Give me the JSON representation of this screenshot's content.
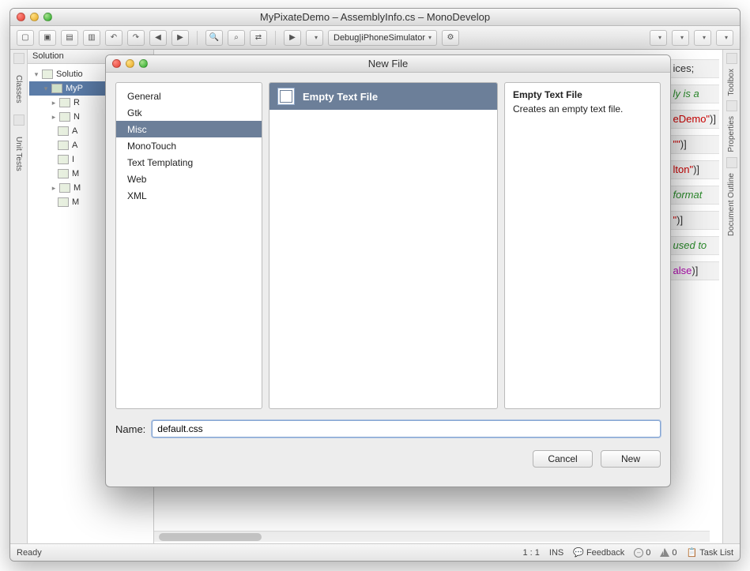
{
  "window": {
    "title": "MyPixateDemo – AssemblyInfo.cs – MonoDevelop"
  },
  "toolbar": {
    "config_label": "Debug|iPhoneSimulator"
  },
  "solution": {
    "panel_title": "Solution",
    "root": "Solutio",
    "project": "MyP",
    "items": [
      "R",
      "N",
      "A",
      "A",
      "I",
      "M",
      "M",
      "M"
    ]
  },
  "right_tabs": [
    "Toolbox",
    "Properties",
    "Document Outline"
  ],
  "left_tabs": [
    "Classes",
    "Unit Tests"
  ],
  "code": {
    "l1": "ices;",
    "l2": "ly is a",
    "l3a": "eDemo\"",
    "l3b": ")]",
    "l4a": "\"\"",
    "l4b": ")]",
    "l5a": "lton\"",
    "l5b": ")]",
    "l6": "format",
    "l7a": "\"",
    "l7b": ")]",
    "l8": "used to",
    "l9a": "alse",
    "l9b": ")]"
  },
  "modal": {
    "title": "New File",
    "categories": [
      "General",
      "Gtk",
      "Misc",
      "MonoTouch",
      "Text Templating",
      "Web",
      "XML"
    ],
    "selected_category": "Misc",
    "template": "Empty Text File",
    "desc_title": "Empty Text File",
    "desc_body": "Creates an empty text file.",
    "name_label": "Name:",
    "name_value": "default.css",
    "cancel": "Cancel",
    "new": "New"
  },
  "status": {
    "ready": "Ready",
    "pos": "1 : 1",
    "ins": "INS",
    "feedback": "Feedback",
    "err": "0",
    "warn": "0",
    "tasklist": "Task List"
  }
}
